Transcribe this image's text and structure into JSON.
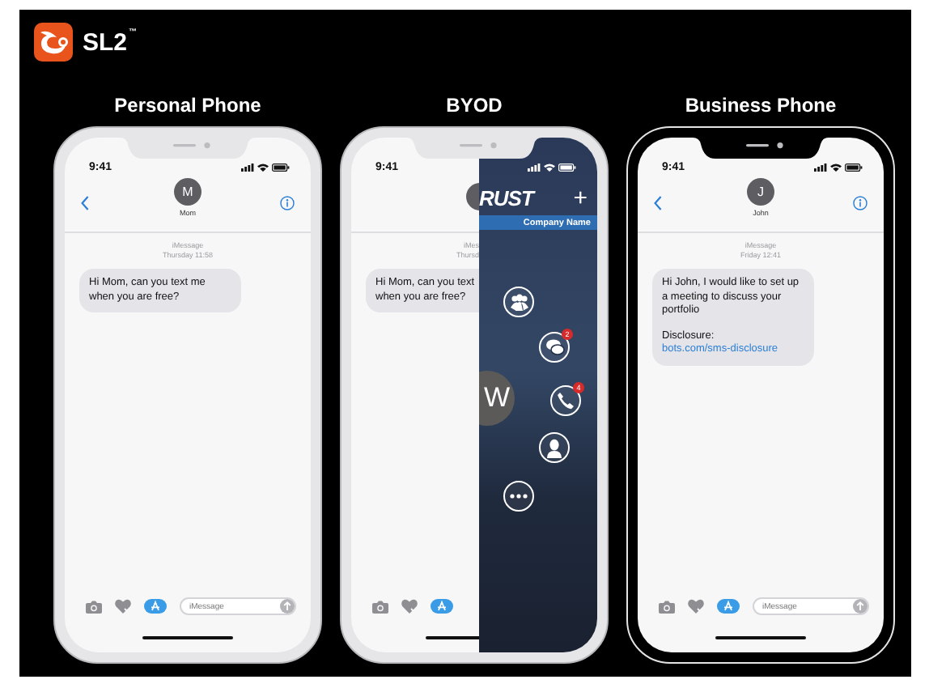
{
  "brand": {
    "name": "SL2",
    "mark": "™"
  },
  "phones": [
    {
      "heading": "Personal Phone",
      "kind": "standard",
      "dark_frame": false,
      "time": "9:41",
      "contact": {
        "initial": "M",
        "name": "Mom"
      },
      "timestamp": [
        "iMessage",
        "Thursday 11:58"
      ],
      "bubble": [
        {
          "lines": [
            {
              "kind": "text",
              "text": "Hi Mom, can you text me when you are free?"
            }
          ]
        }
      ],
      "compose": {
        "placeholder": "iMessage"
      }
    },
    {
      "heading": "BYOD",
      "kind": "split",
      "dark_frame": false,
      "time": "9:41",
      "timestamp": [
        "iMes",
        "Thursd"
      ],
      "bubble": [
        {
          "lines": [
            {
              "kind": "text",
              "text": "Hi Mom, can you text\nwhen you are free?"
            }
          ]
        }
      ],
      "overlay": {
        "logo": "RUST",
        "add": "+",
        "company": "Company Name",
        "letter": "W",
        "actions": [
          {
            "kind": "group"
          },
          {
            "kind": "chat",
            "badge": "2"
          },
          {
            "kind": "phone",
            "badge": "4"
          },
          {
            "kind": "person"
          },
          {
            "kind": "more"
          }
        ]
      }
    },
    {
      "heading": "Business Phone",
      "kind": "standard",
      "dark_frame": true,
      "time": "9:41",
      "contact": {
        "initial": "J",
        "name": "John"
      },
      "timestamp": [
        "iMessage",
        "Friday 12:41"
      ],
      "bubble": [
        {
          "lines": [
            {
              "kind": "text",
              "text": "Hi John, I would like to set up a meeting to discuss your portfolio"
            }
          ]
        },
        {
          "lines": [
            {
              "kind": "text",
              "text": "Disclosure:"
            },
            {
              "kind": "link",
              "text": "bots.com/sms-disclosure"
            }
          ]
        }
      ],
      "compose": {
        "placeholder": "iMessage"
      }
    }
  ]
}
